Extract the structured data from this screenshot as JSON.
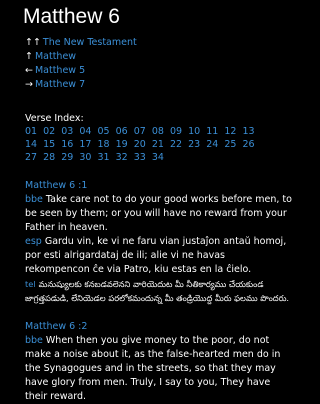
{
  "title": "Matthew 6",
  "nav": [
    {
      "glyph": "↑↑",
      "label": "The New Testament"
    },
    {
      "glyph": "↑",
      "label": "Matthew"
    },
    {
      "glyph": "←",
      "label": "Matthew 5"
    },
    {
      "glyph": "→",
      "label": "Matthew 7"
    }
  ],
  "verse_index_title": "Verse Index:",
  "verse_index": [
    "01",
    "02",
    "03",
    "04",
    "05",
    "06",
    "07",
    "08",
    "09",
    "10",
    "11",
    "12",
    "13",
    "14",
    "15",
    "16",
    "17",
    "18",
    "19",
    "20",
    "21",
    "22",
    "23",
    "24",
    "25",
    "26",
    "27",
    "28",
    "29",
    "30",
    "31",
    "32",
    "33",
    "34"
  ],
  "verses": [
    {
      "ref": "Matthew 6 :1",
      "translations": [
        {
          "code": "bbe",
          "text": "Take care not to do your good works before men, to be seen by them; or you will have no reward from your Father in heaven."
        },
        {
          "code": "esp",
          "text": "Gardu vin, ke vi ne faru vian justaĵon antaŭ homoj, por esti alrigardataj de ili; alie vi ne havas rekompencon ĉe via Patro, kiu estas en la ĉielo."
        },
        {
          "code": "tel",
          "text": "మనుష్యులకు కనబడవలెనని వారియెదుట మీ నీతికార్యము చేయకుండ జాగ్రత్తపడుడి, లేనియెడల పరలోకమందున్న మీ తండ్రియొద్ద మీరు ఫలము పొందరు."
        }
      ]
    },
    {
      "ref": "Matthew 6 :2",
      "translations": [
        {
          "code": "bbe",
          "text": "When then you give money to the poor, do not make a noise about it, as the false-hearted men do in the Synagogues and in the streets, so that they may have glory from men. Truly, I say to you, They have their reward."
        }
      ]
    }
  ]
}
